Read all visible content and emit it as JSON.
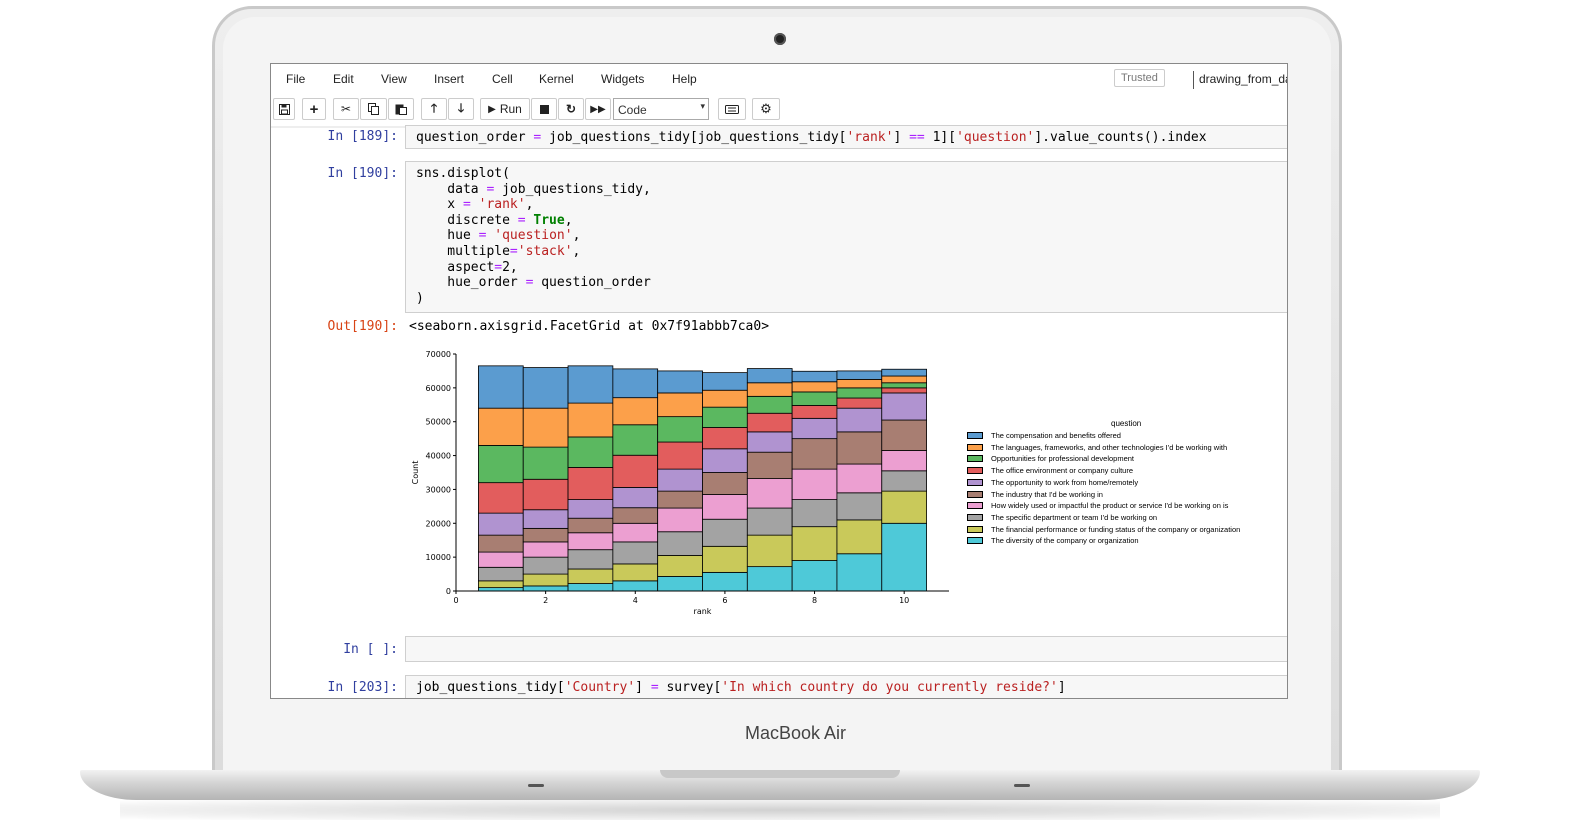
{
  "device": {
    "label": "MacBook Air"
  },
  "menubar": {
    "items": [
      "File",
      "Edit",
      "View",
      "Insert",
      "Cell",
      "Kernel",
      "Widgets",
      "Help"
    ],
    "trusted": "Trusted",
    "notebook_name": "drawing_from_da"
  },
  "toolbar": {
    "run_label": "Run",
    "cell_type": "Code",
    "icons": [
      "save-icon",
      "plus-icon",
      "cut-icon",
      "copy-icon",
      "paste-icon",
      "arrow-up-icon",
      "arrow-down-icon",
      "run-icon",
      "stop-icon",
      "restart-icon",
      "fast-forward-icon",
      "keyboard-icon",
      "settings-icon"
    ]
  },
  "cells": [
    {
      "prompt": "In [189]:",
      "code": "question_order = job_questions_tidy[job_questions_tidy['rank'] == 1]['question'].value_counts().index"
    },
    {
      "prompt": "In [190]:",
      "code": "sns.displot(\n    data = job_questions_tidy,\n    x = 'rank',\n    discrete = True,\n    hue = 'question',\n    multiple='stack',\n    aspect=2,\n    hue_order = question_order\n)"
    },
    {
      "prompt": "Out[190]:",
      "output": "<seaborn.axisgrid.FacetGrid at 0x7f91abbb7ca0>"
    },
    {
      "prompt": "In [ ]:",
      "code": ""
    },
    {
      "prompt": "In [203]:",
      "code": "job_questions_tidy['Country'] = survey['In which country do you currently reside?']"
    }
  ],
  "chart_data": {
    "type": "bar",
    "stacked": true,
    "xlabel": "rank",
    "ylabel": "Count",
    "legend_title": "question",
    "legend_position": "right",
    "xlim": [
      0,
      11
    ],
    "ylim": [
      0,
      70000
    ],
    "xticks": [
      0,
      2,
      4,
      6,
      8,
      10
    ],
    "yticks": [
      0,
      10000,
      20000,
      30000,
      40000,
      50000,
      60000,
      70000
    ],
    "categories": [
      1,
      2,
      3,
      4,
      5,
      6,
      7,
      8,
      9,
      10
    ],
    "series": [
      {
        "name": "The diversity of the company or organization",
        "color": "#4ec9d8",
        "values": [
          1000,
          1500,
          2200,
          3000,
          4300,
          5500,
          7200,
          9000,
          11000,
          20000
        ]
      },
      {
        "name": "The financial performance or funding status of the company or organization",
        "color": "#c9c95a",
        "values": [
          2000,
          3500,
          4300,
          5000,
          6200,
          7700,
          9300,
          10000,
          10000,
          9500
        ]
      },
      {
        "name": "The specific department or team I'd be working on",
        "color": "#a3a3a3",
        "values": [
          4000,
          5000,
          5700,
          6500,
          7000,
          8000,
          8000,
          8000,
          8000,
          6000
        ]
      },
      {
        "name": "How widely used or impactful the product or service I'd be working on is",
        "color": "#ec9fd1",
        "values": [
          4500,
          4500,
          5000,
          5500,
          7000,
          7300,
          8700,
          9000,
          8500,
          6000
        ]
      },
      {
        "name": "The industry that I'd be working in",
        "color": "#a87e72",
        "values": [
          5000,
          4000,
          4300,
          4600,
          5000,
          6500,
          7800,
          9000,
          9500,
          9000
        ]
      },
      {
        "name": "The opportunity to work from home/remotely",
        "color": "#b093d0",
        "values": [
          6500,
          5500,
          5500,
          6000,
          6500,
          7000,
          6000,
          6000,
          7000,
          8000
        ]
      },
      {
        "name": "The office environment or company culture",
        "color": "#e25d5d",
        "values": [
          9000,
          9000,
          9500,
          9500,
          8000,
          6300,
          5500,
          3800,
          3000,
          1500
        ]
      },
      {
        "name": "Opportunities for professional development",
        "color": "#5bb860",
        "values": [
          11000,
          9500,
          9000,
          9000,
          7500,
          6000,
          5000,
          4000,
          3000,
          1500
        ]
      },
      {
        "name": "The languages, frameworks, and other technologies I'd be working with",
        "color": "#fca04a",
        "values": [
          11000,
          11500,
          10000,
          8000,
          7000,
          5000,
          4000,
          3000,
          2500,
          2000
        ]
      },
      {
        "name": "The compensation and benefits offered",
        "color": "#5b9bd0",
        "values": [
          12500,
          12000,
          11000,
          8500,
          6500,
          5200,
          4200,
          3100,
          2500,
          2000
        ]
      }
    ]
  }
}
